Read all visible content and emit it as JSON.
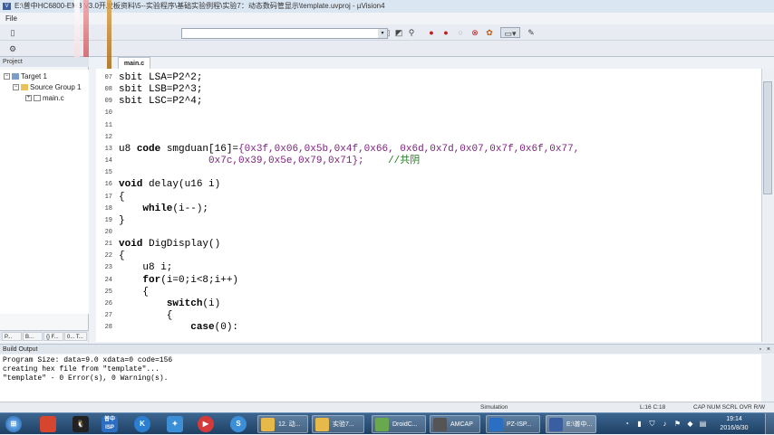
{
  "window": {
    "title": "E:\\普中HC6800-EM3 V3.0开发板资料\\5--实验程序\\基础实验例程\\实验7：动态数码管显示\\template.uvproj - µVision4"
  },
  "menu": {
    "items": [
      "File"
    ]
  },
  "toolbar": {
    "target_combo_value": "",
    "combo_arrow": "▾"
  },
  "project_panel": {
    "header": "Project",
    "tree": {
      "target": "Target 1",
      "group": "Source Group 1",
      "file": "main.c"
    },
    "tabs": [
      "P...",
      "B...",
      "{} F...",
      "0... T..."
    ]
  },
  "editor": {
    "file_tab": "main.c",
    "lines": [
      {
        "num": "07",
        "segments": [
          {
            "t": "sbit LSA=P2^2;",
            "c": "kw0"
          }
        ]
      },
      {
        "num": "08",
        "segments": [
          {
            "t": "sbit LSB=P2^3;",
            "c": "kw0"
          }
        ]
      },
      {
        "num": "09",
        "segments": [
          {
            "t": "sbit LSC=P2^4;",
            "c": "kw0"
          }
        ]
      },
      {
        "num": "10",
        "segments": []
      },
      {
        "num": "11",
        "segments": []
      },
      {
        "num": "12",
        "segments": []
      },
      {
        "num": "13",
        "segments": [
          {
            "t": "u8 ",
            "c": ""
          },
          {
            "t": "code",
            "c": "kw"
          },
          {
            "t": " smgduan[16]=",
            "c": ""
          },
          {
            "t": "{0x3f,0x06,0x5b,0x4f,0x66, 0x6d,0x7d,0x07,0x7f,0x6f,0x77,",
            "c": "hl"
          }
        ]
      },
      {
        "num": "14",
        "segments": [
          {
            "t": "               ",
            "c": ""
          },
          {
            "t": "0x7c,0x39,0x5e,0x79,0x71};",
            "c": "hl"
          },
          {
            "t": "    //共阴",
            "c": "cm"
          }
        ]
      },
      {
        "num": "15",
        "segments": []
      },
      {
        "num": "16",
        "segments": [
          {
            "t": "void",
            "c": "kw"
          },
          {
            "t": " delay(u16 i)",
            "c": ""
          }
        ]
      },
      {
        "num": "17",
        "segments": [
          {
            "t": "{",
            "c": ""
          }
        ]
      },
      {
        "num": "18",
        "segments": [
          {
            "t": "    ",
            "c": ""
          },
          {
            "t": "while",
            "c": "kw"
          },
          {
            "t": "(i--);",
            "c": ""
          }
        ]
      },
      {
        "num": "19",
        "segments": [
          {
            "t": "}",
            "c": ""
          }
        ]
      },
      {
        "num": "20",
        "segments": []
      },
      {
        "num": "21",
        "segments": [
          {
            "t": "void",
            "c": "kw"
          },
          {
            "t": " DigDisplay()",
            "c": ""
          }
        ]
      },
      {
        "num": "22",
        "segments": [
          {
            "t": "{",
            "c": ""
          }
        ]
      },
      {
        "num": "23",
        "segments": [
          {
            "t": "    u8 i;",
            "c": ""
          }
        ]
      },
      {
        "num": "24",
        "segments": [
          {
            "t": "    ",
            "c": ""
          },
          {
            "t": "for",
            "c": "kw"
          },
          {
            "t": "(i=0;i<8;i++)",
            "c": ""
          }
        ]
      },
      {
        "num": "25",
        "segments": [
          {
            "t": "    {",
            "c": ""
          }
        ]
      },
      {
        "num": "26",
        "segments": [
          {
            "t": "        ",
            "c": ""
          },
          {
            "t": "switch",
            "c": "kw"
          },
          {
            "t": "(i)",
            "c": ""
          }
        ]
      },
      {
        "num": "27",
        "segments": [
          {
            "t": "        {",
            "c": ""
          }
        ]
      },
      {
        "num": "28",
        "segments": [
          {
            "t": "            ",
            "c": ""
          },
          {
            "t": "case",
            "c": "kw"
          },
          {
            "t": "(0):",
            "c": ""
          }
        ]
      }
    ]
  },
  "build_output": {
    "header": "Build Output",
    "lines": [
      "Program Size: data=9.0 xdata=0 code=156",
      "creating hex file from \"template\"...",
      "\"template\" - 0 Error(s), 0 Warning(s)."
    ]
  },
  "statusbar": {
    "mode": "Simulation",
    "position": "L:16 C:18",
    "flags": "CAP  NUM  SCRL  OVR  R/W"
  },
  "taskbar": {
    "pinned": [
      {
        "label": "",
        "name": "start",
        "color": "#2d6db5"
      },
      {
        "label": "",
        "name": "app-red",
        "color": "#d6452d"
      },
      {
        "label": "",
        "name": "qq",
        "color": "#2b2b2b"
      },
      {
        "label": "普中ISP",
        "name": "isp",
        "color": "#2a6fc2"
      },
      {
        "label": "K",
        "name": "k-app",
        "color": "#2a7fd0"
      },
      {
        "label": "",
        "name": "network-app",
        "color": "#3a8fd6"
      },
      {
        "label": "▶",
        "name": "player",
        "color": "#d43a3a"
      },
      {
        "label": "S",
        "name": "s-app",
        "color": "#3a8fd6"
      }
    ],
    "apps": [
      {
        "label": "12. 动...",
        "color": "#e7b94a"
      },
      {
        "label": "实验7...",
        "color": "#e7b94a"
      },
      {
        "label": "DroidC...",
        "color": "#6aa84f"
      },
      {
        "label": "AMCAP",
        "color": "#555"
      },
      {
        "label": "PZ-ISP...",
        "color": "#2a6fc2"
      },
      {
        "label": "E:\\普中...",
        "color": "#3a5fa0"
      }
    ],
    "clock_time": "19:14",
    "clock_date": "2016/8/30"
  }
}
